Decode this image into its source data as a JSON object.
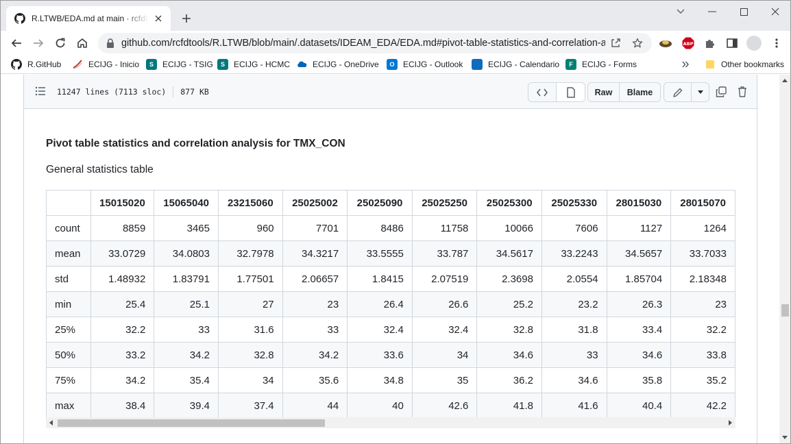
{
  "browser": {
    "tab_title": "R.LTWB/EDA.md at main · rcfdtools/R.LTWB",
    "url": "github.com/rcfdtools/R.LTWB/blob/main/.datasets/IDEAM_EDA/EDA.md#pivot-table-statistics-and-correlation-a...",
    "bookmarks": [
      {
        "label": "R.GitHub",
        "icon": "github-icon",
        "color": "#1f2328"
      },
      {
        "label": "ECIJG - Inicio",
        "icon": "ecijg-icon",
        "color": "#c0392b"
      },
      {
        "label": "ECIJG - TSIG",
        "icon": "sharepoint-icon",
        "color": "#03787c"
      },
      {
        "label": "ECIJG - HCMC",
        "icon": "sharepoint-icon",
        "color": "#03787c"
      },
      {
        "label": "ECIJG - OneDrive",
        "icon": "onedrive-icon",
        "color": "#0364b8"
      },
      {
        "label": "ECIJG - Outlook",
        "icon": "outlook-icon",
        "color": "#0078d4"
      },
      {
        "label": "ECIJG - Calendario",
        "icon": "calendar-icon",
        "color": "#0f6cbd"
      },
      {
        "label": "ECIJG - Forms",
        "icon": "forms-icon",
        "color": "#008272"
      }
    ],
    "other_bookmarks": "Other bookmarks"
  },
  "file": {
    "lines": "11247 lines (7113 sloc)",
    "size": "877 KB",
    "raw_label": "Raw",
    "blame_label": "Blame"
  },
  "content": {
    "heading": "Pivot table statistics and correlation analysis for TMX_CON",
    "subheading": "General statistics table",
    "table": {
      "columns": [
        "",
        "15015020",
        "15065040",
        "23215060",
        "25025002",
        "25025090",
        "25025250",
        "25025300",
        "25025330",
        "28015030",
        "28015070"
      ],
      "rows": [
        [
          "count",
          "8859",
          "3465",
          "960",
          "7701",
          "8486",
          "11758",
          "10066",
          "7606",
          "1127",
          "1264"
        ],
        [
          "mean",
          "33.0729",
          "34.0803",
          "32.7978",
          "34.3217",
          "33.5555",
          "33.787",
          "34.5617",
          "33.2243",
          "34.5657",
          "33.7033"
        ],
        [
          "std",
          "1.48932",
          "1.83791",
          "1.77501",
          "2.06657",
          "1.8415",
          "2.07519",
          "2.3698",
          "2.0554",
          "1.85704",
          "2.18348"
        ],
        [
          "min",
          "25.4",
          "25.1",
          "27",
          "23",
          "26.4",
          "26.6",
          "25.2",
          "23.2",
          "26.3",
          "23"
        ],
        [
          "25%",
          "32.2",
          "33",
          "31.6",
          "33",
          "32.4",
          "32.4",
          "32.8",
          "31.8",
          "33.4",
          "32.2"
        ],
        [
          "50%",
          "33.2",
          "34.2",
          "32.8",
          "34.2",
          "33.6",
          "34",
          "34.6",
          "33",
          "34.6",
          "33.8"
        ],
        [
          "75%",
          "34.2",
          "35.4",
          "34",
          "35.6",
          "34.8",
          "35",
          "36.2",
          "34.6",
          "35.8",
          "35.2"
        ],
        [
          "max",
          "38.4",
          "39.4",
          "37.4",
          "44",
          "40",
          "42.6",
          "41.8",
          "41.6",
          "40.4",
          "42.2"
        ]
      ]
    }
  }
}
